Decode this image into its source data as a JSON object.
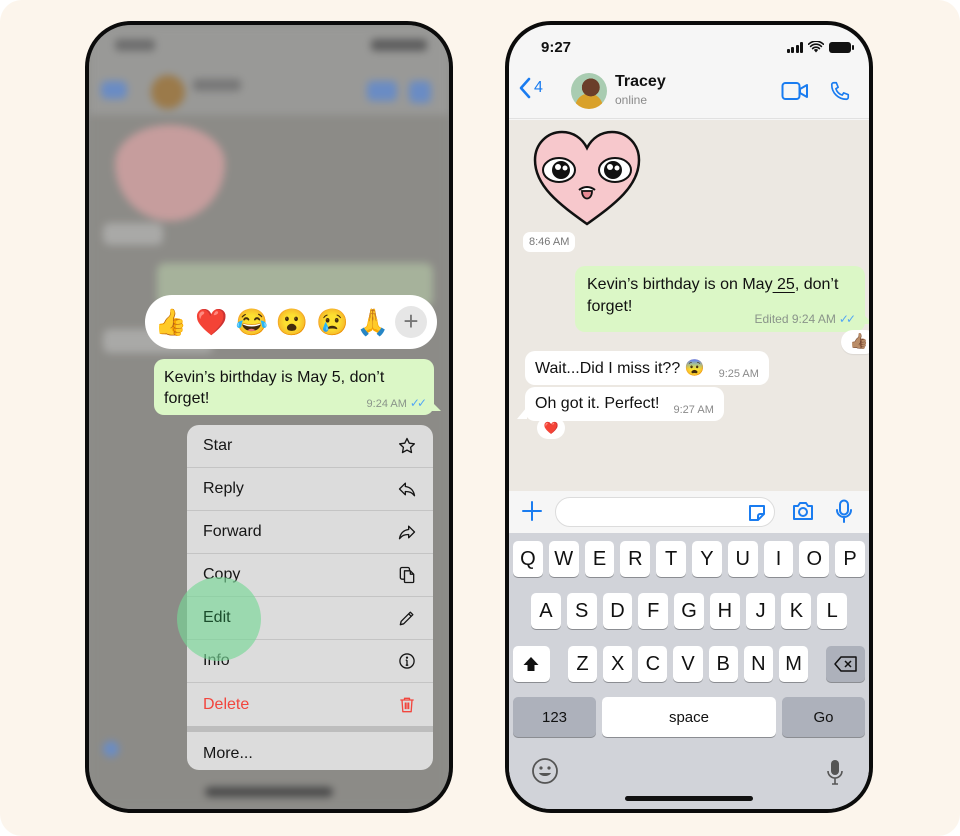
{
  "left_phone": {
    "reactions": [
      "👍",
      "❤️",
      "😂",
      "😮",
      "😢",
      "🙏"
    ],
    "reaction_more_label": "+",
    "selected_message": {
      "text": "Kevin’s birthday is May 5, don’t forget!",
      "time": "9:24 AM",
      "ticks": "✓✓"
    },
    "menu": {
      "items": [
        {
          "label": "Star",
          "icon": "star-icon"
        },
        {
          "label": "Reply",
          "icon": "reply-icon"
        },
        {
          "label": "Forward",
          "icon": "forward-icon"
        },
        {
          "label": "Copy",
          "icon": "copy-icon"
        },
        {
          "label": "Edit",
          "icon": "pencil-icon"
        },
        {
          "label": "Info",
          "icon": "info-icon"
        },
        {
          "label": "Delete",
          "icon": "trash-icon"
        }
      ],
      "more_label": "More..."
    },
    "colors": {
      "delete": "#f2453d",
      "tap_highlight": "#78d796"
    }
  },
  "right_phone": {
    "status": {
      "time": "9:27"
    },
    "header": {
      "back_count": "4",
      "contact_name": "Tracey",
      "presence": "online"
    },
    "chat": {
      "sticker_time": "8:46 AM",
      "outgoing": {
        "text_before": "Kevin’s birthday is  on May",
        "text_underlined": " 25",
        "text_after": ", don’t forget!",
        "edited_meta": "Edited 9:24 AM",
        "ticks": "✓✓",
        "reaction": "👍🏽"
      },
      "incoming": [
        {
          "text": "Wait...Did I miss it?? 😨",
          "time": "9:25 AM"
        },
        {
          "text": "Oh got it. Perfect!",
          "time": "9:27 AM",
          "reaction": "❤️"
        }
      ]
    },
    "composer": {
      "input_value": "",
      "input_placeholder": ""
    },
    "keyboard": {
      "row1": [
        "Q",
        "W",
        "E",
        "R",
        "T",
        "Y",
        "U",
        "I",
        "O",
        "P"
      ],
      "row2": [
        "A",
        "S",
        "D",
        "F",
        "G",
        "H",
        "J",
        "K",
        "L"
      ],
      "row3": [
        "Z",
        "X",
        "C",
        "V",
        "B",
        "N",
        "M"
      ],
      "numbers_label": "123",
      "space_label": "space",
      "go_label": "Go"
    },
    "colors": {
      "accent": "#1a7cf0",
      "outgoing_bubble": "#dbf7c6",
      "chat_bg": "#ece8e2"
    }
  }
}
